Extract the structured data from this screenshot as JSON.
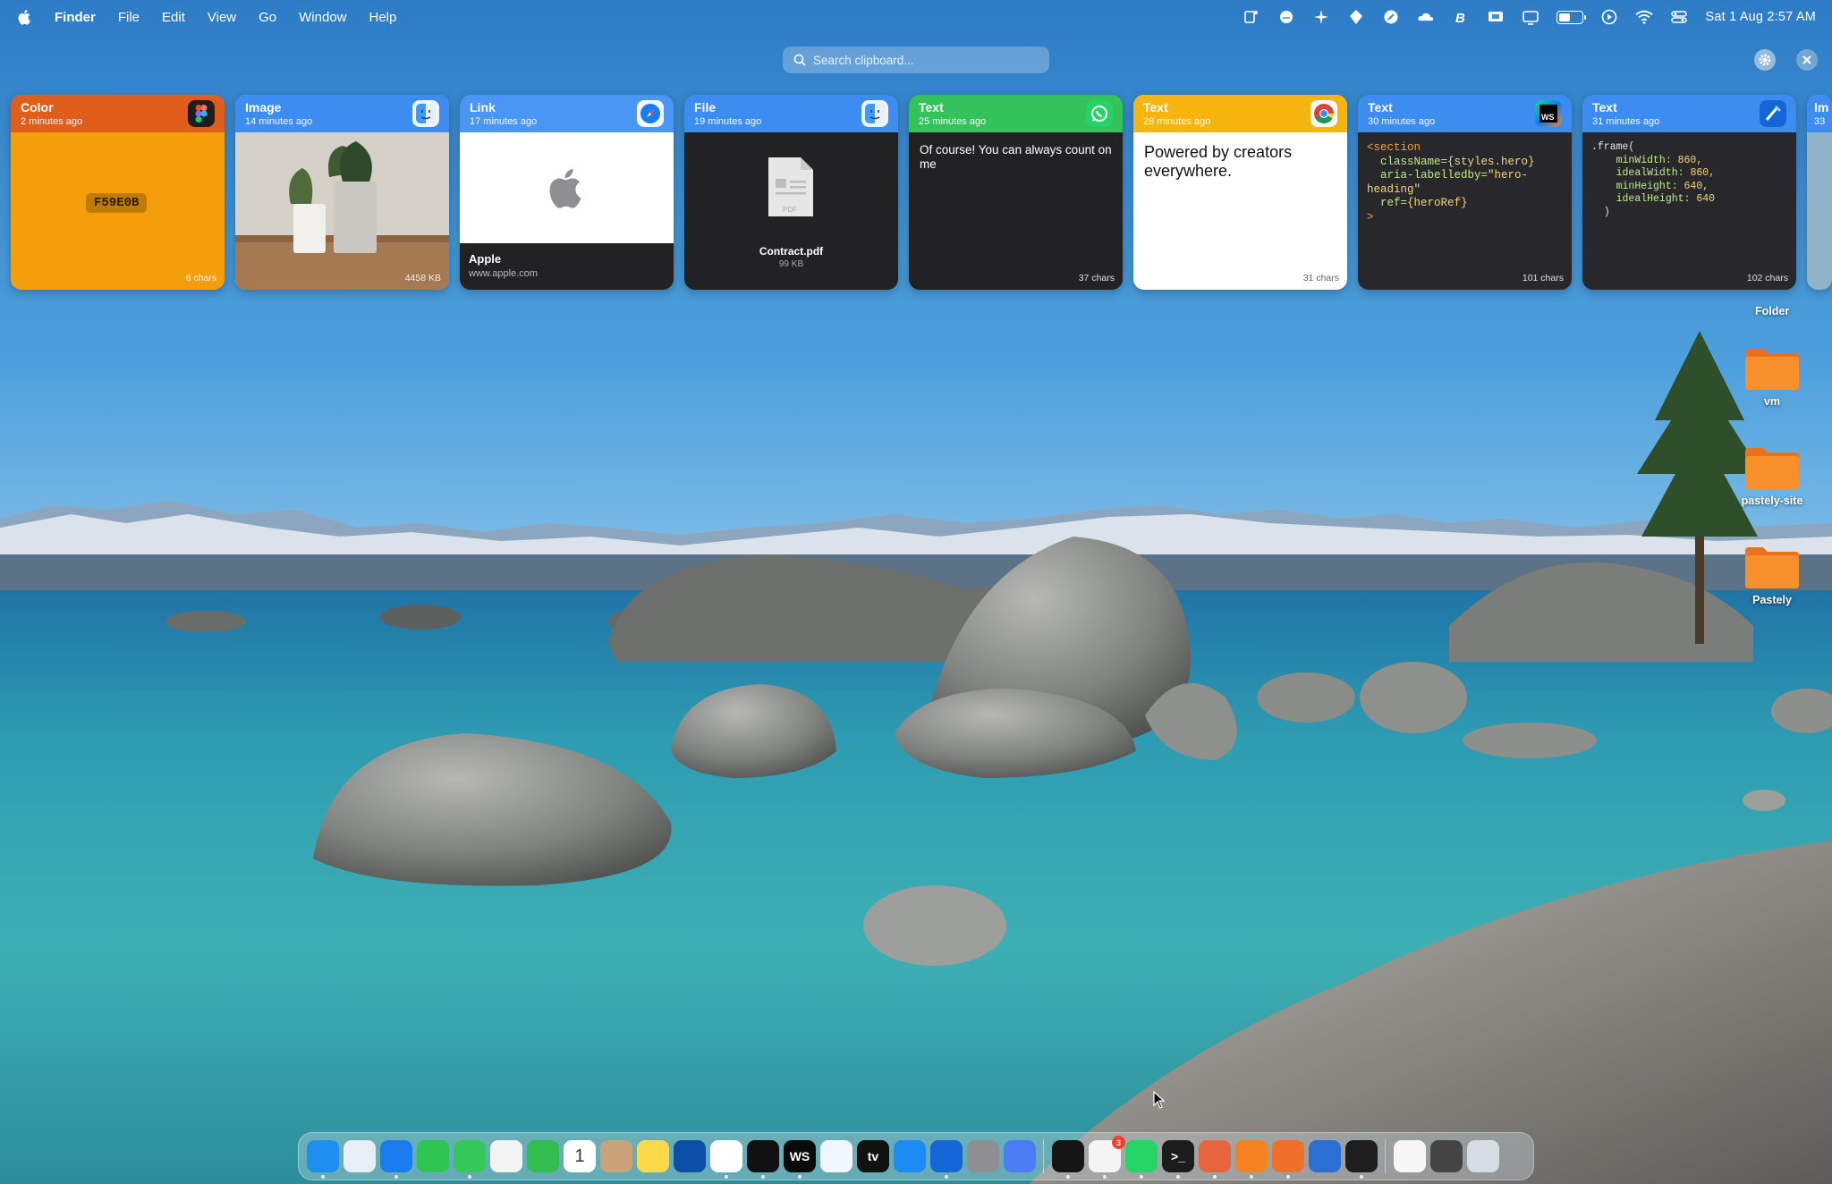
{
  "menubar": {
    "app_name": "Finder",
    "menus": [
      "File",
      "Edit",
      "View",
      "Go",
      "Window",
      "Help"
    ],
    "status_icons": [
      "stage-manager-icon",
      "cloud-sync-icon",
      "sparkle-icon",
      "shield-icon",
      "color-picker-icon",
      "cloud-icon",
      "b-app-icon",
      "display-icon",
      "screen-icon",
      "battery-icon",
      "play-icon",
      "wifi-icon",
      "control-center-icon"
    ],
    "battery_percent": "48",
    "battery_level": 0.48,
    "clock": "Sat 1 Aug  2:57 AM"
  },
  "search": {
    "placeholder": "Search clipboard..."
  },
  "cards": [
    {
      "type": "Color",
      "time": "2 minutes ago",
      "value": "F59E0B",
      "footer": "6 chars",
      "color": "#F59E0B",
      "header_color": "#e05e1c",
      "app": "figma-icon"
    },
    {
      "type": "Image",
      "time": "14 minutes ago",
      "footer": "4458 KB",
      "header_color": "#3d8cf0",
      "app": "finder-icon"
    },
    {
      "type": "Link",
      "time": "17 minutes ago",
      "title": "Apple",
      "url": "www.apple.com",
      "header_color": "#4a96f5",
      "app": "safari-icon"
    },
    {
      "type": "File",
      "time": "19 minutes ago",
      "file_name": "Contract.pdf",
      "file_size": "99 KB",
      "file_ext": "PDF",
      "header_color": "#3d8cf0",
      "app": "finder-icon"
    },
    {
      "type": "Text",
      "time": "25 minutes ago",
      "text": "Of course! You can always count on me",
      "footer": "37 chars",
      "header_color": "#33c35a",
      "app": "whatsapp-icon"
    },
    {
      "type": "Text",
      "time": "28 minutes ago",
      "text": "Powered by creators everywhere.",
      "footer": "31 chars",
      "header_color": "#f6b40e",
      "app": "chrome-icon"
    },
    {
      "type": "Text",
      "time": "30 minutes ago",
      "footer": "101 chars",
      "header_color": "#3d8cf0",
      "app": "webstorm-icon",
      "code": {
        "l1": "<section",
        "l2a": "className=",
        "l2b": "{styles.hero}",
        "l3a": "aria-labelledby=",
        "l3b": "\"hero-",
        "l4": "heading\"",
        "l5a": "ref=",
        "l5b": "{heroRef}",
        "l6": ">"
      }
    },
    {
      "type": "Text",
      "time": "31 minutes ago",
      "footer": "102 chars",
      "header_color": "#3d8cf0",
      "app": "xcode-icon",
      "code": {
        "l1": ".frame(",
        "l2a": "minWidth: ",
        "l2b": "860,",
        "l3a": "idealWidth: ",
        "l3b": "860,",
        "l4a": "minHeight: ",
        "l4b": "640,",
        "l5a": "idealHeight: ",
        "l5b": "640",
        "l6": ")"
      }
    },
    {
      "type": "Im",
      "time": "33"
    }
  ],
  "desktop": {
    "folder_header": "Folder",
    "folders": [
      "vm",
      "pastely-site",
      "Pastely"
    ]
  },
  "dock": {
    "apps": [
      {
        "name": "finder-icon",
        "color": "#1e8ff0",
        "running": true
      },
      {
        "name": "launchpad-icon",
        "color": "#e8eef6"
      },
      {
        "name": "safari-icon",
        "color": "#1b7cf2",
        "running": true
      },
      {
        "name": "phone-icon",
        "color": "#2fc552"
      },
      {
        "name": "messages-icon",
        "color": "#34c759",
        "running": true
      },
      {
        "name": "photos-icon",
        "color": "#f3f3f3"
      },
      {
        "name": "facetime-icon",
        "color": "#2fbe4f"
      },
      {
        "name": "calendar-icon",
        "color": "#ffffff",
        "label": "1"
      },
      {
        "name": "contacts-icon",
        "color": "#c9a27a"
      },
      {
        "name": "notes-icon",
        "color": "#fcd949"
      },
      {
        "name": "freeform-icon",
        "color": "#0b4fa8"
      },
      {
        "name": "chrome-icon",
        "color": "#ffffff",
        "running": true
      },
      {
        "name": "spotify-icon",
        "color": "#111111",
        "running": true
      },
      {
        "name": "webstorm-icon",
        "color": "#0a0a0a",
        "label": "WS",
        "running": true
      },
      {
        "name": "instruments-icon",
        "color": "#f2f6ff"
      },
      {
        "name": "apple-tv-icon",
        "color": "#111111",
        "label": "tv"
      },
      {
        "name": "app-store-icon",
        "color": "#1c8cf4"
      },
      {
        "name": "xcode-icon",
        "color": "#1466d6",
        "running": true
      },
      {
        "name": "system-settings-icon",
        "color": "#8e8e93"
      },
      {
        "name": "simulator-icon",
        "color": "#4b7cf6"
      },
      {
        "name": "separator"
      },
      {
        "name": "cursor-app-icon",
        "color": "#151515",
        "running": true
      },
      {
        "name": "slack-icon",
        "color": "#f4f4f4",
        "badge": "3",
        "running": true
      },
      {
        "name": "whatsapp-icon",
        "color": "#25d366",
        "running": true
      },
      {
        "name": "terminal-icon",
        "color": "#1c1c1c",
        "label": ">_",
        "running": true
      },
      {
        "name": "claude-icon",
        "color": "#e8643c",
        "running": true
      },
      {
        "name": "cloudflare-icon",
        "color": "#f6821f",
        "running": true
      },
      {
        "name": "pastely-icon",
        "color": "#f0702a",
        "running": true
      },
      {
        "name": "word-icon",
        "color": "#2b6fd4"
      },
      {
        "name": "figma-icon",
        "color": "#1e1e1e",
        "running": true
      },
      {
        "name": "separator"
      },
      {
        "name": "preview-doc-icon",
        "color": "#f7f7f7"
      },
      {
        "name": "downloads-stack-icon",
        "color": "#444444"
      },
      {
        "name": "trash-icon",
        "color": "#d8dde3"
      }
    ]
  }
}
